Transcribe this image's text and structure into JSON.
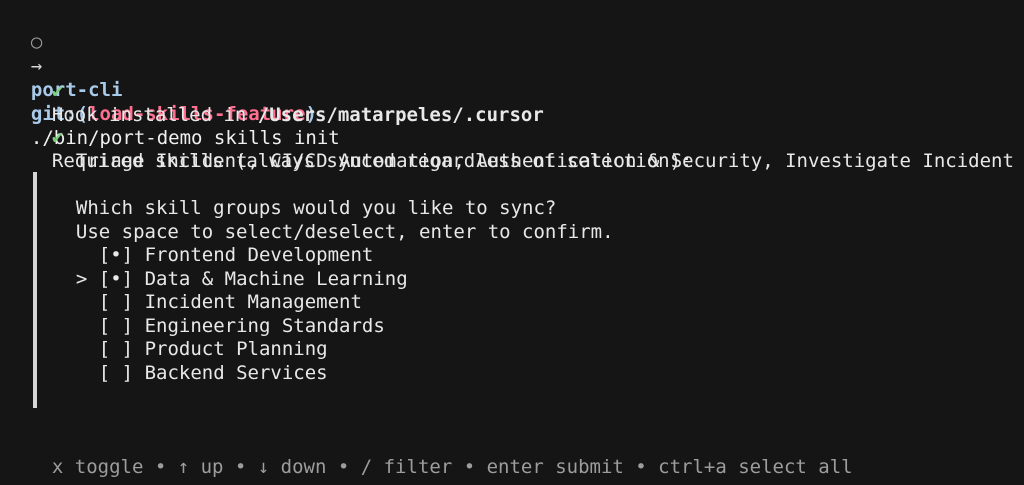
{
  "prompt": {
    "circle": "○",
    "arrow": "→",
    "repo": "port-cli",
    "git_label": "git:",
    "open_paren": "(",
    "branch": "load-skills-feature",
    "close_paren": ")",
    "command": "./bin/port-demo skills init"
  },
  "hook": {
    "check": "✔",
    "text": "Hook installed in ",
    "path": "/Users/matarpeles/.cursor"
  },
  "required": {
    "check": "✔",
    "text": "Required skills (always synced regardless of selection):",
    "skills": "Triage Incident, CI/CD Automation, Authentication & Security, Investigate Incident"
  },
  "selection": {
    "question": "Which skill groups would you like to sync?",
    "instructions": "Use space to select/deselect, enter to confirm.",
    "cursor": ">",
    "options": [
      {
        "box": "[•]",
        "label": "Frontend Development"
      },
      {
        "box": "[•]",
        "label": "Data & Machine Learning"
      },
      {
        "box": "[ ]",
        "label": "Incident Management"
      },
      {
        "box": "[ ]",
        "label": "Engineering Standards"
      },
      {
        "box": "[ ]",
        "label": "Product Planning"
      },
      {
        "box": "[ ]",
        "label": "Backend Services"
      }
    ]
  },
  "help": {
    "text": "x toggle • ↑ up • ↓ down • / filter • enter submit • ctrl+a select all"
  },
  "colors": {
    "background": "#151515",
    "branch": "#ff6f8f",
    "repo": "#a9c9e8",
    "check": "#7dd07d"
  }
}
